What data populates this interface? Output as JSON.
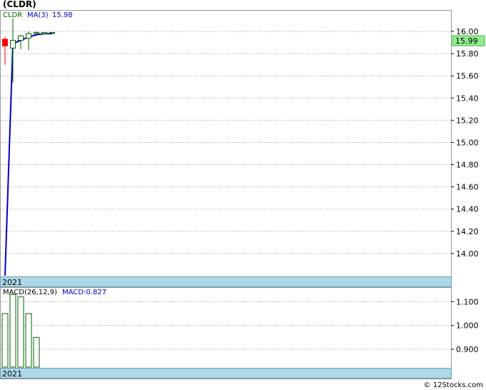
{
  "header": {
    "title": "(CLDR)",
    "watermark": "© 12Stocks.com"
  },
  "price_panel": {
    "ticker_label": "CLDR",
    "ma_label": "MA(3)",
    "ma_value": "15.98",
    "current_price": "15.99",
    "year_label": "2021"
  },
  "macd_panel": {
    "label": "MACD(26,12,9)",
    "macd_text": "MACD:0.827",
    "year_label": "2021"
  },
  "colors": {
    "up_candle": "#006400",
    "down_candle": "#ff0000",
    "ma_line": "#0000cc",
    "macd_bar": "#006400",
    "year_band": "#add8e6",
    "price_badge": "#90ee90"
  },
  "chart_data": [
    {
      "type": "candlestick",
      "title": "(CLDR)",
      "ylim": [
        13.8,
        16.18
      ],
      "yticks": [
        "14.00",
        "14.20",
        "14.40",
        "14.60",
        "14.80",
        "15.00",
        "15.20",
        "15.40",
        "15.60",
        "15.80",
        "16.00"
      ],
      "grid": true,
      "candles": [
        {
          "open": 15.93,
          "close": 15.87,
          "high": 15.95,
          "low": 15.7,
          "dir": "down"
        },
        {
          "open": 15.85,
          "close": 15.92,
          "high": 16.12,
          "low": 15.54,
          "dir": "up"
        },
        {
          "open": 15.92,
          "close": 15.96,
          "high": 15.97,
          "low": 15.84,
          "dir": "up"
        },
        {
          "open": 15.94,
          "close": 15.98,
          "high": 16.0,
          "low": 15.83,
          "dir": "up"
        },
        {
          "open": 15.98,
          "close": 15.99,
          "high": 16.0,
          "low": 15.96,
          "dir": "up"
        },
        {
          "open": 15.98,
          "close": 15.99,
          "high": 15.99,
          "low": 15.97,
          "dir": "up"
        },
        {
          "open": 15.99,
          "close": 15.99,
          "high": 15.99,
          "low": 15.98,
          "dir": "up"
        }
      ],
      "ma_series": {
        "name": "MA(3)",
        "values": [
          13.8,
          15.89,
          15.92,
          15.95,
          15.97,
          15.98,
          15.98
        ]
      }
    },
    {
      "type": "bar",
      "title": "MACD(26,12,9)",
      "ylim": [
        0.825,
        1.155
      ],
      "yticks": [
        "0.900",
        "1.000",
        "1.100"
      ],
      "grid": true,
      "values": [
        1.05,
        1.13,
        1.12,
        1.05,
        0.95,
        0.82,
        0.82
      ]
    }
  ]
}
